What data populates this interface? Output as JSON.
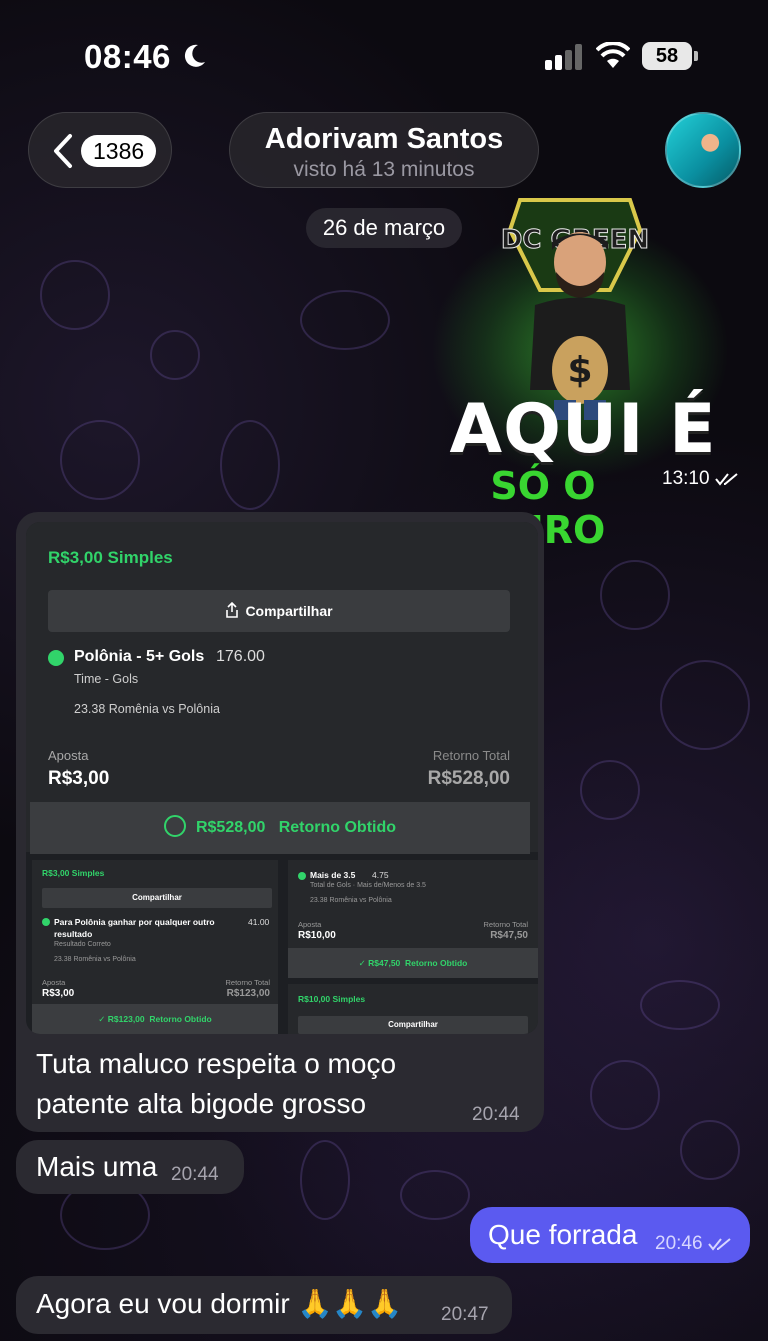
{
  "status_bar": {
    "time": "08:46",
    "battery": "58"
  },
  "header": {
    "unread_count": "1386",
    "contact_name": "Adorivam Santos",
    "contact_status": "visto há 13 minutos"
  },
  "date_separator": "26 de março",
  "sticker": {
    "shield_text": "DC GREEN",
    "line1": "AQUI É",
    "line2": "SÓ O OURO",
    "time": "13:10"
  },
  "bet_card": {
    "title": "R$3,00 Simples",
    "share_label": "Compartilhar",
    "selection": "Polônia - 5+ Gols",
    "odds": "176.00",
    "market": "Time - Gols",
    "event": "23.38 Romênia vs Polônia",
    "stake_label": "Aposta",
    "stake_value": "R$3,00",
    "return_label": "Retorno Total",
    "return_value": "R$528,00",
    "result_amount": "R$528,00",
    "result_label": "Retorno Obtido"
  },
  "mini_left": {
    "title": "R$3,00 Simples",
    "share_label": "Compartilhar",
    "selection_line1": "Para Polônia ganhar por qualquer outro",
    "selection_line2": "resultado",
    "odds": "41.00",
    "market": "Resultado Correto",
    "event": "23.38 Romênia vs Polônia",
    "stake_label": "Aposta",
    "stake_value": "R$3,00",
    "return_label": "Retorno Total",
    "return_value": "R$123,00",
    "result_amount": "R$123,00",
    "result_label": "Retorno Obtido"
  },
  "mini_right_top": {
    "selection": "Mais de 3.5",
    "odds": "4.75",
    "market": "Total de Gols · Mais de/Menos de 3.5",
    "event": "23.38 Romênia vs Polônia",
    "stake_label": "Aposta",
    "stake_value": "R$10,00",
    "return_label": "Retorno Total",
    "return_value": "R$47,50",
    "result_amount": "R$47,50",
    "result_label": "Retorno Obtido"
  },
  "mini_right_bottom": {
    "title": "R$10,00 Simples",
    "share_label": "Compartilhar"
  },
  "messages": [
    {
      "text_line1": "Tuta maluco respeita o moço",
      "text_line2": "patente alta bigode grosso",
      "time": "20:44"
    },
    {
      "text": "Mais uma",
      "time": "20:44"
    },
    {
      "text": "Que forrada",
      "time": "20:46"
    },
    {
      "text": "Agora eu vou dormir 🙏🙏🙏",
      "time": "20:47"
    }
  ],
  "colors": {
    "accent_green": "#31d46a",
    "outgoing_bubble": "#5b5af0",
    "incoming_bubble": "#2b2a31"
  },
  "icons": [
    "moon-icon",
    "signal-icon",
    "wifi-icon",
    "battery-icon",
    "chevron-left-icon",
    "share-icon",
    "check-circle-icon",
    "double-check-icon"
  ]
}
